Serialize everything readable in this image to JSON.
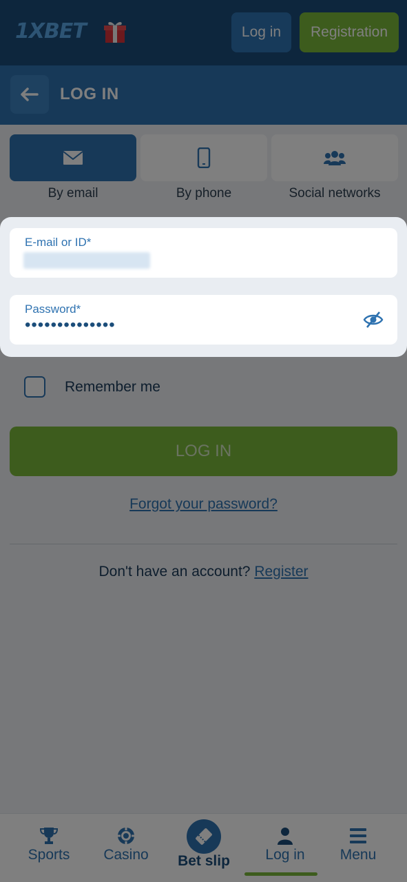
{
  "topbar": {
    "logo": "1XBET",
    "login_label": "Log in",
    "registration_label": "Registration"
  },
  "header": {
    "title": "LOG IN"
  },
  "tabs": [
    {
      "label": "By email",
      "icon": "envelope-icon",
      "active": true
    },
    {
      "label": "By phone",
      "icon": "phone-icon",
      "active": false
    },
    {
      "label": "Social networks",
      "icon": "people-icon",
      "active": false
    }
  ],
  "form": {
    "email_label": "E-mail or ID*",
    "password_label": "Password*",
    "password_value": "••••••••••••••"
  },
  "remember_label": "Remember me",
  "login_button": "LOG IN",
  "forgot_link": "Forgot your password?",
  "signup": {
    "text": "Don't have an account?",
    "link": "Register"
  },
  "bottomnav": {
    "items": [
      {
        "label": "Sports",
        "icon": "trophy-icon"
      },
      {
        "label": "Casino",
        "icon": "casino-chip-icon"
      },
      {
        "label": "Bet slip",
        "icon": "ticket-icon"
      },
      {
        "label": "Log in",
        "icon": "user-icon"
      },
      {
        "label": "Menu",
        "icon": "hamburger-icon"
      }
    ]
  },
  "colors": {
    "primary": "#2e72b0",
    "dark_blue": "#1b4d7a",
    "green": "#7bb83b"
  }
}
